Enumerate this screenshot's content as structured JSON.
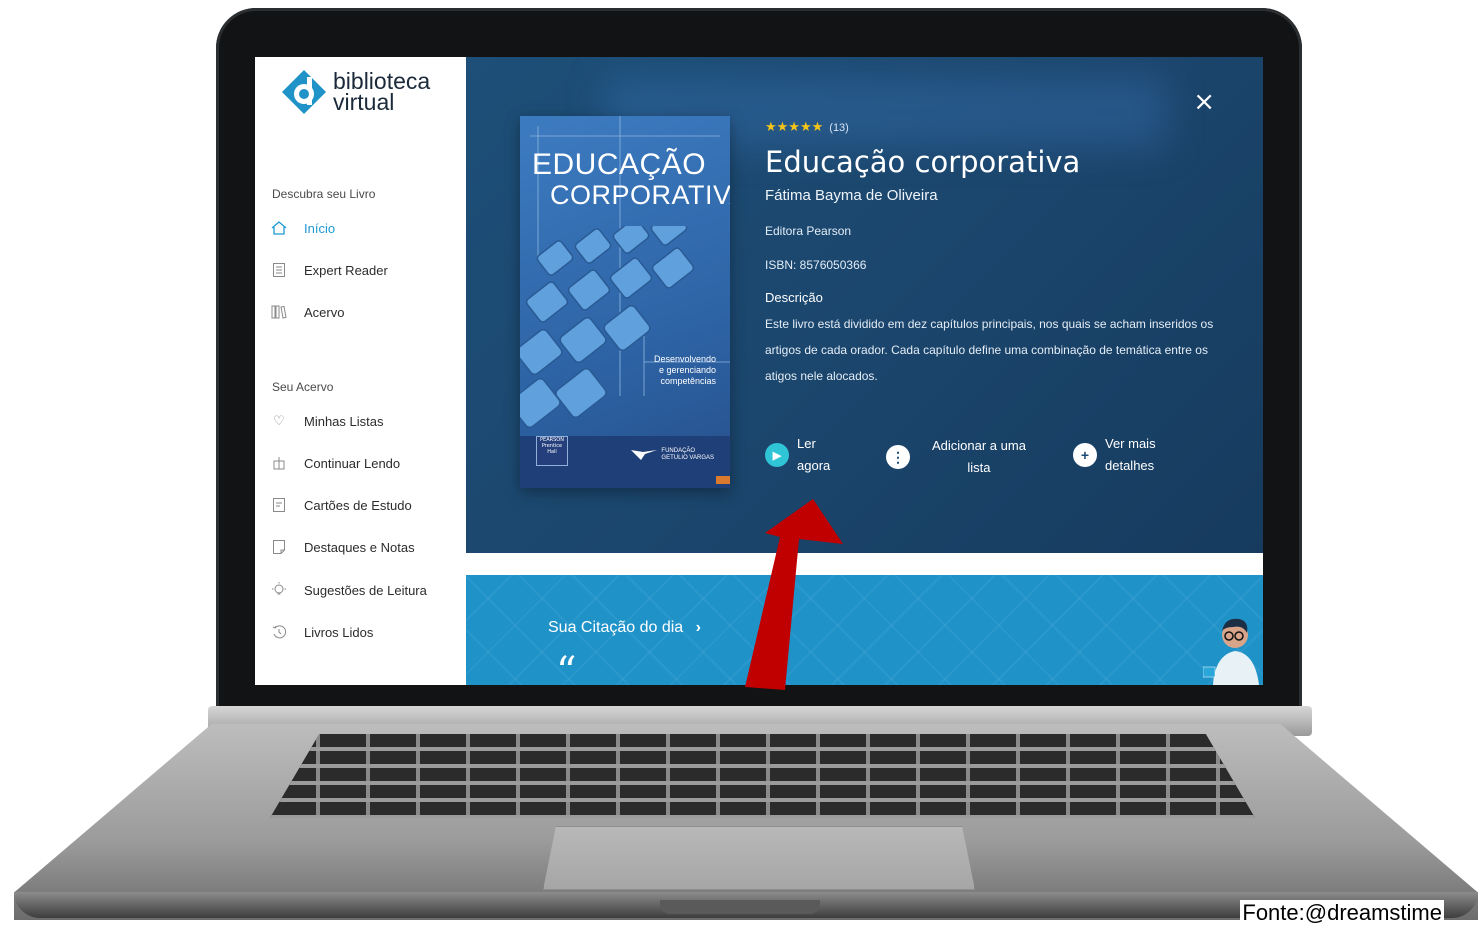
{
  "sidebar": {
    "logo": {
      "line1": "biblioteca",
      "line2": "virtual"
    },
    "section1_title": "Descubra seu Livro",
    "section1_items": [
      {
        "label": "Início",
        "icon": "home-icon",
        "active": true
      },
      {
        "label": "Expert Reader",
        "icon": "reader-icon",
        "active": false
      },
      {
        "label": "Acervo",
        "icon": "library-icon",
        "active": false
      }
    ],
    "section2_title": "Seu Acervo",
    "section2_items": [
      {
        "label": "Minhas Listas",
        "icon": "heart-icon"
      },
      {
        "label": "Continuar Lendo",
        "icon": "book-open-icon"
      },
      {
        "label": "Cartões de Estudo",
        "icon": "card-icon"
      },
      {
        "label": "Destaques e Notas",
        "icon": "note-icon"
      },
      {
        "label": "Sugestões de Leitura",
        "icon": "lightbulb-icon"
      },
      {
        "label": "Livros Lidos",
        "icon": "history-icon"
      }
    ]
  },
  "book": {
    "cover": {
      "title_line1": "EDUCAÇÃO",
      "title_line2": "CORPORATIVA",
      "subtitle": [
        "Desenvolvendo",
        "e gerenciando",
        "competências"
      ],
      "publisher_logo": "PEARSON",
      "publisher_sub": "Prentice Hall",
      "foundation": [
        "FUNDAÇÃO",
        "GETULIO VARGAS"
      ]
    },
    "stars": "★★★★★",
    "rating_value": 5,
    "rating_count": "(13)",
    "title": "Educação corporativa",
    "author": "Fátima Bayma de Oliveira",
    "publisher": "Editora Pearson",
    "isbn": "ISBN: 8576050366",
    "description_heading": "Descrição",
    "description": "Este livro está dividido em dez capítulos principais, nos quais se acham inseridos os artigos de cada orador. Cada capítulo define uma combinação de temática entre os atigos nele alocados."
  },
  "actions": {
    "read_now_l1": "Ler",
    "read_now_l2": "agora",
    "add_list_l1": "Adicionar a uma",
    "add_list_l2": "lista",
    "more_l1": "Ver mais",
    "more_l2": "detalhes"
  },
  "close_label": "×",
  "quote": {
    "link": "Sua Citação do dia",
    "chevron": "›",
    "mark": "“"
  },
  "credit": "Fonte:@dreamstime",
  "colors": {
    "panel": "#1b456c",
    "accent": "#1e9ad6",
    "band": "#1f92c8",
    "arrow": "#c00000",
    "stars": "#f5c518"
  }
}
